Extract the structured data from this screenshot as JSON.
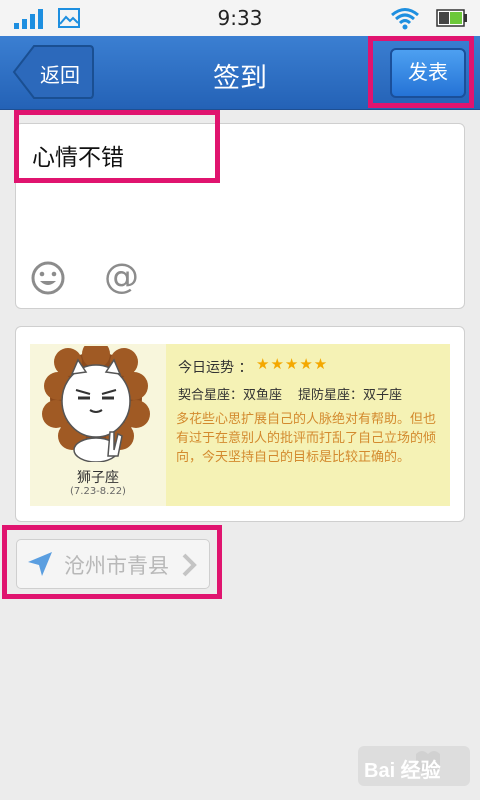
{
  "status_bar": {
    "time": "9:33",
    "icons": [
      "signal-icon",
      "gallery-icon",
      "wifi-icon",
      "battery-icon"
    ]
  },
  "header": {
    "back_label": "返回",
    "title": "签到",
    "publish_label": "发表",
    "accent_color": "#2a6bc0"
  },
  "compose": {
    "text": "心情不错",
    "emoji_icon": "smile-icon",
    "mention_symbol": "@"
  },
  "horoscope": {
    "sign": "狮子座",
    "date_range": "(7.23-8.22)",
    "fortune_label": "今日运势 ：",
    "stars": "★★★★★",
    "star_rating": 5,
    "match": "契合星座：双鱼座",
    "beware": "提防星座：双子座",
    "description": "多花些心思扩展自己的人脉绝对有帮助。但也有过于在意别人的批评而打乱了自己立场的倾向，今天坚持自己的目标是比较正确的。"
  },
  "location": {
    "text": "沧州市青县"
  },
  "highlight_color": "#e0146f",
  "watermark": {
    "text": "Bai 经验"
  }
}
